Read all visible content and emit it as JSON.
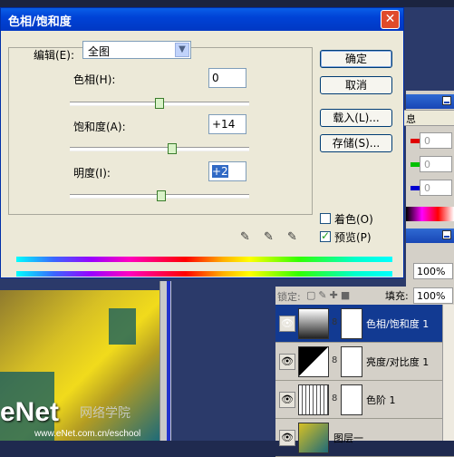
{
  "dialog": {
    "title": "色相/饱和度",
    "close_symbol": "✕",
    "edit_label": "编辑(E):",
    "edit_value": "全图",
    "hue": {
      "label": "色相(H):",
      "value": "0",
      "level": 0.5
    },
    "saturation": {
      "label": "饱和度(A):",
      "value": "+14",
      "level": 0.57
    },
    "lightness": {
      "label": "明度(I):",
      "value": "+2",
      "level": 0.51
    },
    "buttons": {
      "ok": "确定",
      "cancel": "取消",
      "load": "载入(L)...",
      "save": "存储(S)..."
    },
    "colorize": {
      "label": "着色(O)",
      "checked": false
    },
    "preview": {
      "label": "预览(P)",
      "checked": true
    }
  },
  "layers_panel": {
    "opacity": "100%",
    "lock_label": "锁定:",
    "fill_label": "填充:",
    "fill": "100%",
    "layers": [
      {
        "name": "色相/饱和度 1",
        "selected": true
      },
      {
        "name": "亮度/对比度 1",
        "selected": false
      },
      {
        "name": "色阶 1",
        "selected": false
      },
      {
        "name": "图层一",
        "selected": false
      }
    ]
  },
  "info_panel": {
    "tab": "息",
    "values": [
      "0",
      "0",
      "0"
    ]
  },
  "watermark": {
    "logo": "eNet",
    "chinese": "网络学院",
    "url": "www.eNet.com.cn/eschool"
  },
  "colors": {
    "title_bar": "#0042d6",
    "selected_layer": "#123a92",
    "close_button": "#e04b2a"
  }
}
